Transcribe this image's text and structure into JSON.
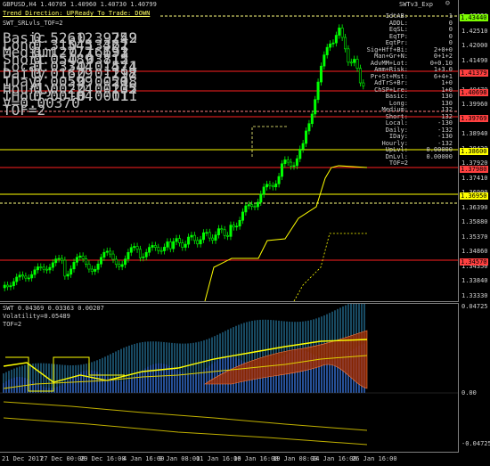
{
  "header": {
    "symbol_info": "GBPUSD,H4  1.40705 1.40960 1.40730 1.40799",
    "indicator_name": "SWTv3_Exp",
    "trend_direction": "Trend Direction:  UP",
    "ready_to_trade": "Ready To Trade:  DOWN",
    "strategy": "SWT_SRLvls_TOF=2"
  },
  "left_table": {
    "rows": [
      {
        "name": "Basic",
        "a": "0.52612",
        "b": "-0.39249",
        "c": "-75",
        "d": "-2"
      },
      {
        "name": "Long",
        "a": "0.31545",
        "b": "0.13362",
        "c": "42",
        "d": "1"
      },
      {
        "name": "Medium",
        "a": "0.12777",
        "b": "0.16693",
        "c": "131",
        "d": "2"
      },
      {
        "name": "Short",
        "a": "0.05489",
        "b": "0.03815",
        "c": "71",
        "d": "2"
      },
      {
        "name": "Local",
        "a": "0.03344",
        "b": "-0.01574",
        "c": "-47",
        "d": "-1"
      },
      {
        "name": "Daily",
        "a": "0.01629",
        "b": "-0.01297",
        "c": "-118",
        "d": "-2"
      },
      {
        "name": "IDay",
        "a": "0.00599",
        "b": "-0.00298",
        "c": "-50",
        "d": "1"
      },
      {
        "name": "Hourly",
        "a": "0.00224",
        "b": "-0.00235",
        "c": "-105",
        "d": "-2"
      },
      {
        "name": "IHour",
        "a": "0.00104",
        "b": "-0.00011",
        "c": "-11",
        "d": "1"
      }
    ],
    "v_line": "V=0.00370",
    "tof_line": "TOF=2"
  },
  "right_table": {
    "rows": [
      {
        "k": "IdtAB:",
        "v": "1"
      },
      {
        "k": "ADDL:",
        "v": "0"
      },
      {
        "k": "EqSL:",
        "v": "0"
      },
      {
        "k": "EqTP:",
        "v": "0"
      },
      {
        "k": "EqtPr:",
        "v": "0"
      },
      {
        "k": "Sig+Hff+Bi:",
        "v": "2+0+0"
      },
      {
        "k": "Man+Gr+N:",
        "v": "0+1+2"
      },
      {
        "k": "AdvMM+Lot:",
        "v": "0+0.10"
      },
      {
        "k": "Amm+Risk:",
        "v": "1+3.0"
      },
      {
        "k": "Pr+St+Mst:",
        "v": "6+4+1"
      },
      {
        "k": "AdTrS+Br:",
        "v": "1+0"
      },
      {
        "k": "ChSP+Lre:",
        "v": "1+0"
      },
      {
        "k": "Basic:",
        "v": "130"
      },
      {
        "k": "Long:",
        "v": "130"
      },
      {
        "k": "Medium:",
        "v": "132"
      },
      {
        "k": "Short:",
        "v": "132"
      },
      {
        "k": "Local:",
        "v": "-130"
      },
      {
        "k": "Daily:",
        "v": "-132"
      },
      {
        "k": "IDay:",
        "v": "-130"
      },
      {
        "k": "Hourly:",
        "v": "-132"
      },
      {
        "k": "UpLvl:",
        "v": "0.00000"
      },
      {
        "k": "DnLvl:",
        "v": "0.00000"
      },
      {
        "k": "TOF=2",
        "v": ""
      }
    ]
  },
  "price_scale": {
    "labels": [
      "1.43020",
      "1.42510",
      "1.42000",
      "1.41490",
      "1.40980",
      "1.40470",
      "1.39960",
      "1.39450",
      "1.38940",
      "1.38430",
      "1.37920",
      "1.37410",
      "1.36900",
      "1.36390",
      "1.35880",
      "1.35370",
      "1.34860",
      "1.34350",
      "1.33840",
      "1.33330"
    ],
    "tags": [
      {
        "text": "1.43440",
        "color": "#7cfc00"
      },
      {
        "text": "1.41379",
        "color": "#ff4040"
      },
      {
        "text": "1.40698",
        "color": "#ff4040"
      },
      {
        "text": "1.39769",
        "color": "#ff4040"
      },
      {
        "text": "1.38600",
        "color": "#ffff00"
      },
      {
        "text": "1.37980",
        "color": "#ff4040"
      },
      {
        "text": "1.36950",
        "color": "#ffff00"
      },
      {
        "text": "1.34570",
        "color": "#ff4040"
      }
    ]
  },
  "sub_window": {
    "title": "SWT 0.04369 0.03363 0.00207",
    "volatility": "Volatility=0.05489",
    "tof": "TOF=2",
    "scale_top": "0.04725",
    "scale_zero": "0.00",
    "scale_bottom": "-0.04725"
  },
  "time_axis": [
    "21 Dec 2017",
    "27 Dec 00:00",
    "29 Dec 16:00",
    "4 Jan 16:00",
    "9 Jan 08:00",
    "11 Jan 16:00",
    "16 Jan 16:00",
    "19 Jan 08:00",
    "24 Jan 16:00",
    "26 Jan 16:00"
  ],
  "colors": {
    "bull_candle": "#00ff00",
    "bear_candle": "#00a000",
    "level_red": "#ff2020",
    "level_yellow": "#ffff00",
    "label_yellow": "#ffff66",
    "label_red": "#ff5050",
    "sub_blue": "#3060c0",
    "sub_cyan": "#40c0ff",
    "sub_brown": "#b03000"
  }
}
